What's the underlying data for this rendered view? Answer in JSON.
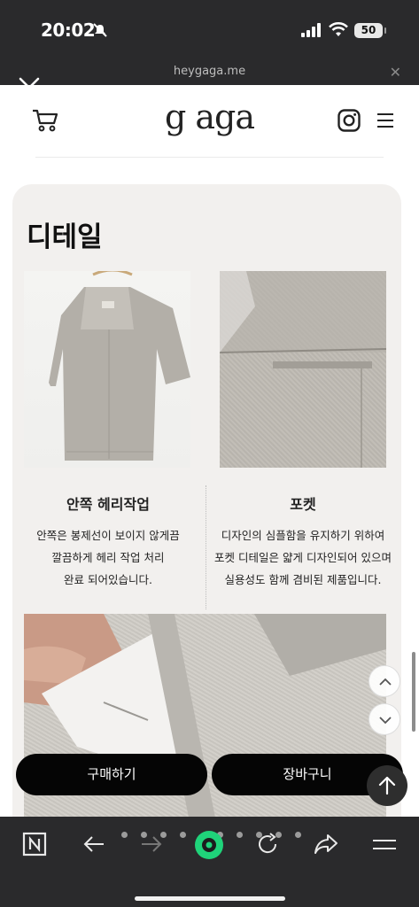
{
  "status": {
    "time": "20:02",
    "battery": "50"
  },
  "browser": {
    "url": "heygaga.me",
    "close_symbol": "✕"
  },
  "site": {
    "logo": "g aga"
  },
  "detail": {
    "title": "디테일",
    "items": [
      {
        "heading": "안쪽 헤리작업",
        "lines": [
          "안쪽은 봉제선이 보이지 않게끔",
          "깔끔하게 헤리 작업 처리",
          "완료 되어있습니다."
        ]
      },
      {
        "heading": "포켓",
        "lines": [
          "디자인의 심플함을 유지하기 위하여",
          "포켓 디테일은 얇게 디자인되어 있으며",
          "실용성도 함께 겸비된 제품입니다."
        ]
      }
    ]
  },
  "actions": {
    "buy_label": "구매하기",
    "cart_label": "장바구니"
  },
  "icons": {
    "close": "close-icon",
    "cart": "cart-icon",
    "instagram": "instagram-icon",
    "menu": "hamburger-menu-icon",
    "scroll_up": "chevron-up-icon",
    "scroll_down": "chevron-down-icon",
    "back_to_top": "arrow-up-icon",
    "tabs": "tab-switcher-icon",
    "back": "back-arrow-icon",
    "forward": "forward-arrow-icon",
    "home": "home-icon",
    "reload": "reload-icon",
    "share": "share-icon",
    "browser_menu": "menu-icon"
  },
  "colors": {
    "accent": "#1fd37a",
    "button_bg": "#050505",
    "card_bg": "#f2f0ee"
  }
}
